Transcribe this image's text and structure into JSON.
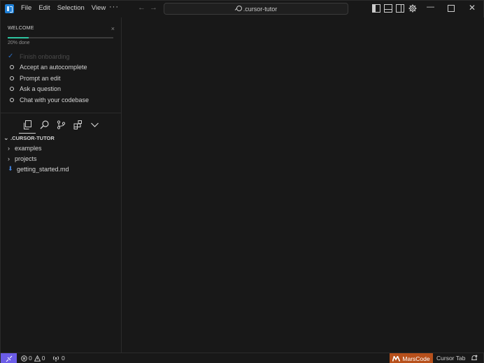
{
  "titlebar": {
    "menu": [
      "File",
      "Edit",
      "Selection",
      "View"
    ],
    "more": "···",
    "search_text": ".cursor-tutor"
  },
  "welcome": {
    "title": "WELCOME",
    "close": "×",
    "progress": 0.2,
    "progress_label": "20% done",
    "items": [
      {
        "label": "Finish onboarding",
        "done": true
      },
      {
        "label": "Accept an autocomplete",
        "done": false
      },
      {
        "label": "Prompt an edit",
        "done": false
      },
      {
        "label": "Ask a question",
        "done": false
      },
      {
        "label": "Chat with your codebase",
        "done": false
      }
    ]
  },
  "explorer": {
    "root": ".CURSOR-TUTOR",
    "entries": [
      {
        "label": "examples",
        "type": "folder"
      },
      {
        "label": "projects",
        "type": "folder"
      },
      {
        "label": "getting_started.md",
        "type": "file"
      }
    ]
  },
  "statusbar": {
    "errors": "0",
    "warnings": "0",
    "ports": "0",
    "marscode": "MarsCode",
    "cursor_tab": "Cursor Tab"
  },
  "colors": {
    "accent_progress": "#2ec4a0",
    "remote": "#6b5ce7",
    "marscode": "#b7501b"
  }
}
